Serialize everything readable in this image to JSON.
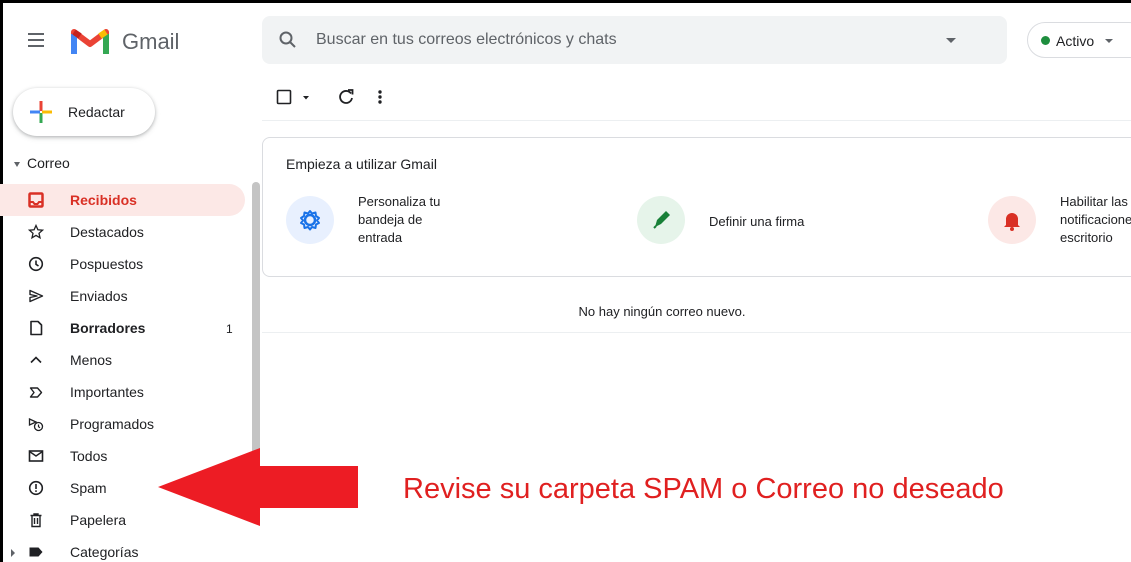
{
  "header": {
    "app_name": "Gmail",
    "search_placeholder": "Buscar en tus correos electrónicos y chats",
    "status_label": "Activo",
    "status_color": "#1e8e3e",
    "icons": [
      "menu-icon",
      "gmail-logo",
      "search-icon",
      "search-options-icon",
      "caret-down-icon"
    ]
  },
  "compose": {
    "label": "Redactar"
  },
  "sidebar": {
    "section_label": "Correo",
    "items": [
      {
        "label": "Recibidos",
        "icon": "inbox-icon",
        "active": true,
        "bold": true
      },
      {
        "label": "Destacados",
        "icon": "star-icon"
      },
      {
        "label": "Pospuestos",
        "icon": "clock-icon"
      },
      {
        "label": "Enviados",
        "icon": "send-icon"
      },
      {
        "label": "Borradores",
        "icon": "draft-icon",
        "bold": true,
        "count": "1"
      },
      {
        "label": "Menos",
        "icon": "chevron-up-icon"
      },
      {
        "label": "Importantes",
        "icon": "important-icon"
      },
      {
        "label": "Programados",
        "icon": "scheduled-icon"
      },
      {
        "label": "Todos",
        "icon": "all-mail-icon"
      },
      {
        "label": "Spam",
        "icon": "spam-icon"
      },
      {
        "label": "Papelera",
        "icon": "trash-icon"
      },
      {
        "label": "Categorías",
        "icon": "label-icon",
        "expandable": true
      }
    ]
  },
  "toolbar": {
    "icons": [
      "checkbox-icon",
      "caret-down-icon",
      "refresh-icon",
      "more-vert-icon"
    ]
  },
  "getting_started": {
    "title": "Empieza a utilizar Gmail",
    "features": [
      {
        "text": "Personaliza tu\nbandeja de\nentrada",
        "icon": "settings-icon",
        "bg": "#e8f0fe",
        "color": "#1a73e8"
      },
      {
        "text": "Definir una firma",
        "icon": "pen-icon",
        "bg": "#e6f4ea",
        "color": "#188038"
      },
      {
        "text": "Habilitar las\nnotificaciones de\nescritorio",
        "icon": "bell-icon",
        "bg": "#fce8e6",
        "color": "#d93025"
      }
    ]
  },
  "inbox": {
    "empty_message": "No hay ningún correo nuevo."
  },
  "annotation": {
    "text": "Revise su carpeta SPAM  o Correo no deseado",
    "color": "#e02020"
  }
}
